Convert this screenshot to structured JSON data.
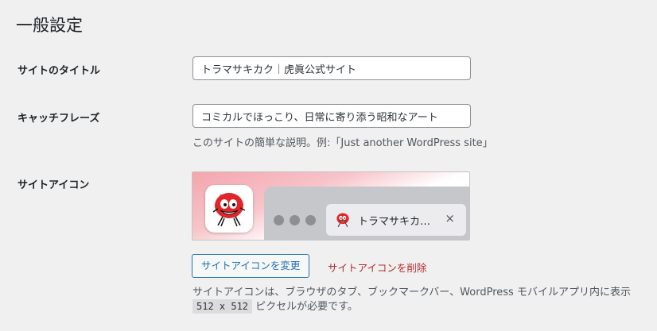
{
  "page": {
    "title": "一般設定"
  },
  "fields": {
    "site_title": {
      "label": "サイトのタイトル",
      "value": "トラマサキカク｜虎眞公式サイト"
    },
    "tagline": {
      "label": "キャッチフレーズ",
      "value": "コミカルでほっこり、日常に寄り添う昭和なアート",
      "description": "このサイトの簡単な説明。例:「Just another WordPress site」"
    },
    "site_icon": {
      "label": "サイトアイコン",
      "tab_title": "トラマサキカ…",
      "tab_close": "×",
      "change_button": "サイトアイコンを変更",
      "remove_link": "サイトアイコンを削除",
      "description_line1": "サイトアイコンは、ブラウザのタブ、ブックマークバー、WordPress モバイルアプリ内に表示",
      "size_code": "512 x 512",
      "description_line2_suffix": " ピクセルが必要です。"
    }
  },
  "colors": {
    "background": "#f0f0f1",
    "accent": "#2271b1",
    "danger": "#b32d2e",
    "mascot_red": "#e0262a"
  },
  "icons": [
    "mascot-logo-icon",
    "close-icon"
  ]
}
